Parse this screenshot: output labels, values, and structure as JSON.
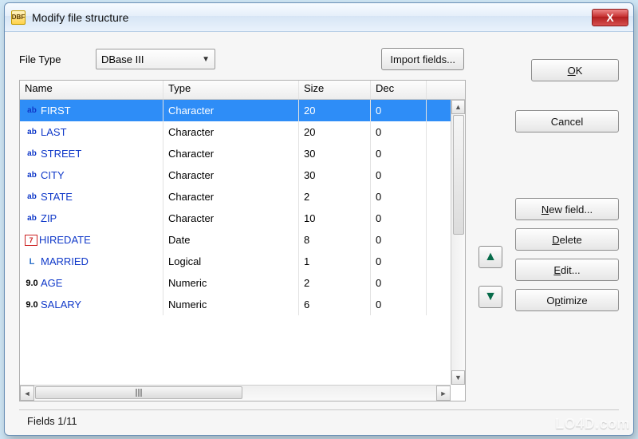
{
  "window": {
    "title": "Modify file structure",
    "close_glyph": "X"
  },
  "file_type": {
    "label": "File Type",
    "value": "DBase III"
  },
  "buttons": {
    "import_fields": "Import fields...",
    "ok": "OK",
    "cancel": "Cancel",
    "new_field": "New field...",
    "delete": "Delete",
    "edit": "Edit...",
    "optimize": "Optimize"
  },
  "columns": {
    "name": "Name",
    "type": "Type",
    "size": "Size",
    "dec": "Dec"
  },
  "fields": [
    {
      "icon": "char",
      "name": "FIRST",
      "type": "Character",
      "size": "20",
      "dec": "0",
      "selected": true
    },
    {
      "icon": "char",
      "name": "LAST",
      "type": "Character",
      "size": "20",
      "dec": "0"
    },
    {
      "icon": "char",
      "name": "STREET",
      "type": "Character",
      "size": "30",
      "dec": "0"
    },
    {
      "icon": "char",
      "name": "CITY",
      "type": "Character",
      "size": "30",
      "dec": "0"
    },
    {
      "icon": "char",
      "name": "STATE",
      "type": "Character",
      "size": "2",
      "dec": "0"
    },
    {
      "icon": "char",
      "name": "ZIP",
      "type": "Character",
      "size": "10",
      "dec": "0"
    },
    {
      "icon": "date",
      "name": "HIREDATE",
      "type": "Date",
      "size": "8",
      "dec": "0"
    },
    {
      "icon": "logical",
      "name": "MARRIED",
      "type": "Logical",
      "size": "1",
      "dec": "0"
    },
    {
      "icon": "num",
      "name": "AGE",
      "type": "Numeric",
      "size": "2",
      "dec": "0"
    },
    {
      "icon": "num",
      "name": "SALARY",
      "type": "Numeric",
      "size": "6",
      "dec": "0"
    }
  ],
  "status": "Fields 1/11",
  "watermark": "LO4D.com",
  "icons": {
    "char_glyph": "ab",
    "date_glyph": "7",
    "logical_glyph": "L",
    "num_glyph": "9.0",
    "up_arrow": "▲",
    "down_arrow": "▼",
    "dropdown_arrow": "▼",
    "scroll_up": "▲",
    "scroll_down": "▼",
    "scroll_left": "◄",
    "scroll_right": "►"
  }
}
